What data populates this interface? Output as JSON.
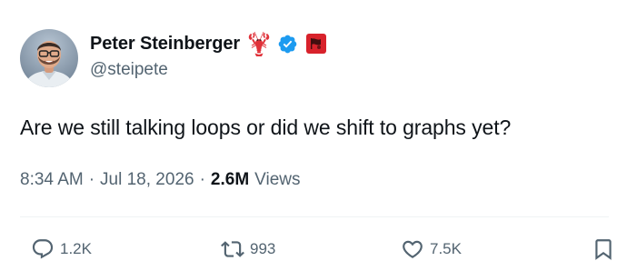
{
  "author": {
    "display_name": "Peter Steinberger",
    "handle": "@steipete",
    "verified": true,
    "name_emoji_icon": "lobster-icon",
    "badge_icon": "red-flag-badge-icon",
    "avatar_icon": "avatar"
  },
  "tweet": {
    "text": "Are we still talking loops or did we shift to graphs yet?"
  },
  "meta": {
    "time": "8:34 AM",
    "separator": "·",
    "date": "Jul 18, 2026",
    "views_count": "2.6M",
    "views_label": "Views"
  },
  "actions": {
    "reply": {
      "icon": "reply-icon",
      "count": "1.2K"
    },
    "retweet": {
      "icon": "retweet-icon",
      "count": "993"
    },
    "like": {
      "icon": "heart-icon",
      "count": "7.5K"
    },
    "bookmark": {
      "icon": "bookmark-icon"
    }
  },
  "colors": {
    "text_primary": "#0f1419",
    "text_secondary": "#536471",
    "verified_blue": "#1d9bf0",
    "lobster_red": "#e0323a",
    "badge_red": "#d8222b",
    "divider": "#eff3f4"
  }
}
